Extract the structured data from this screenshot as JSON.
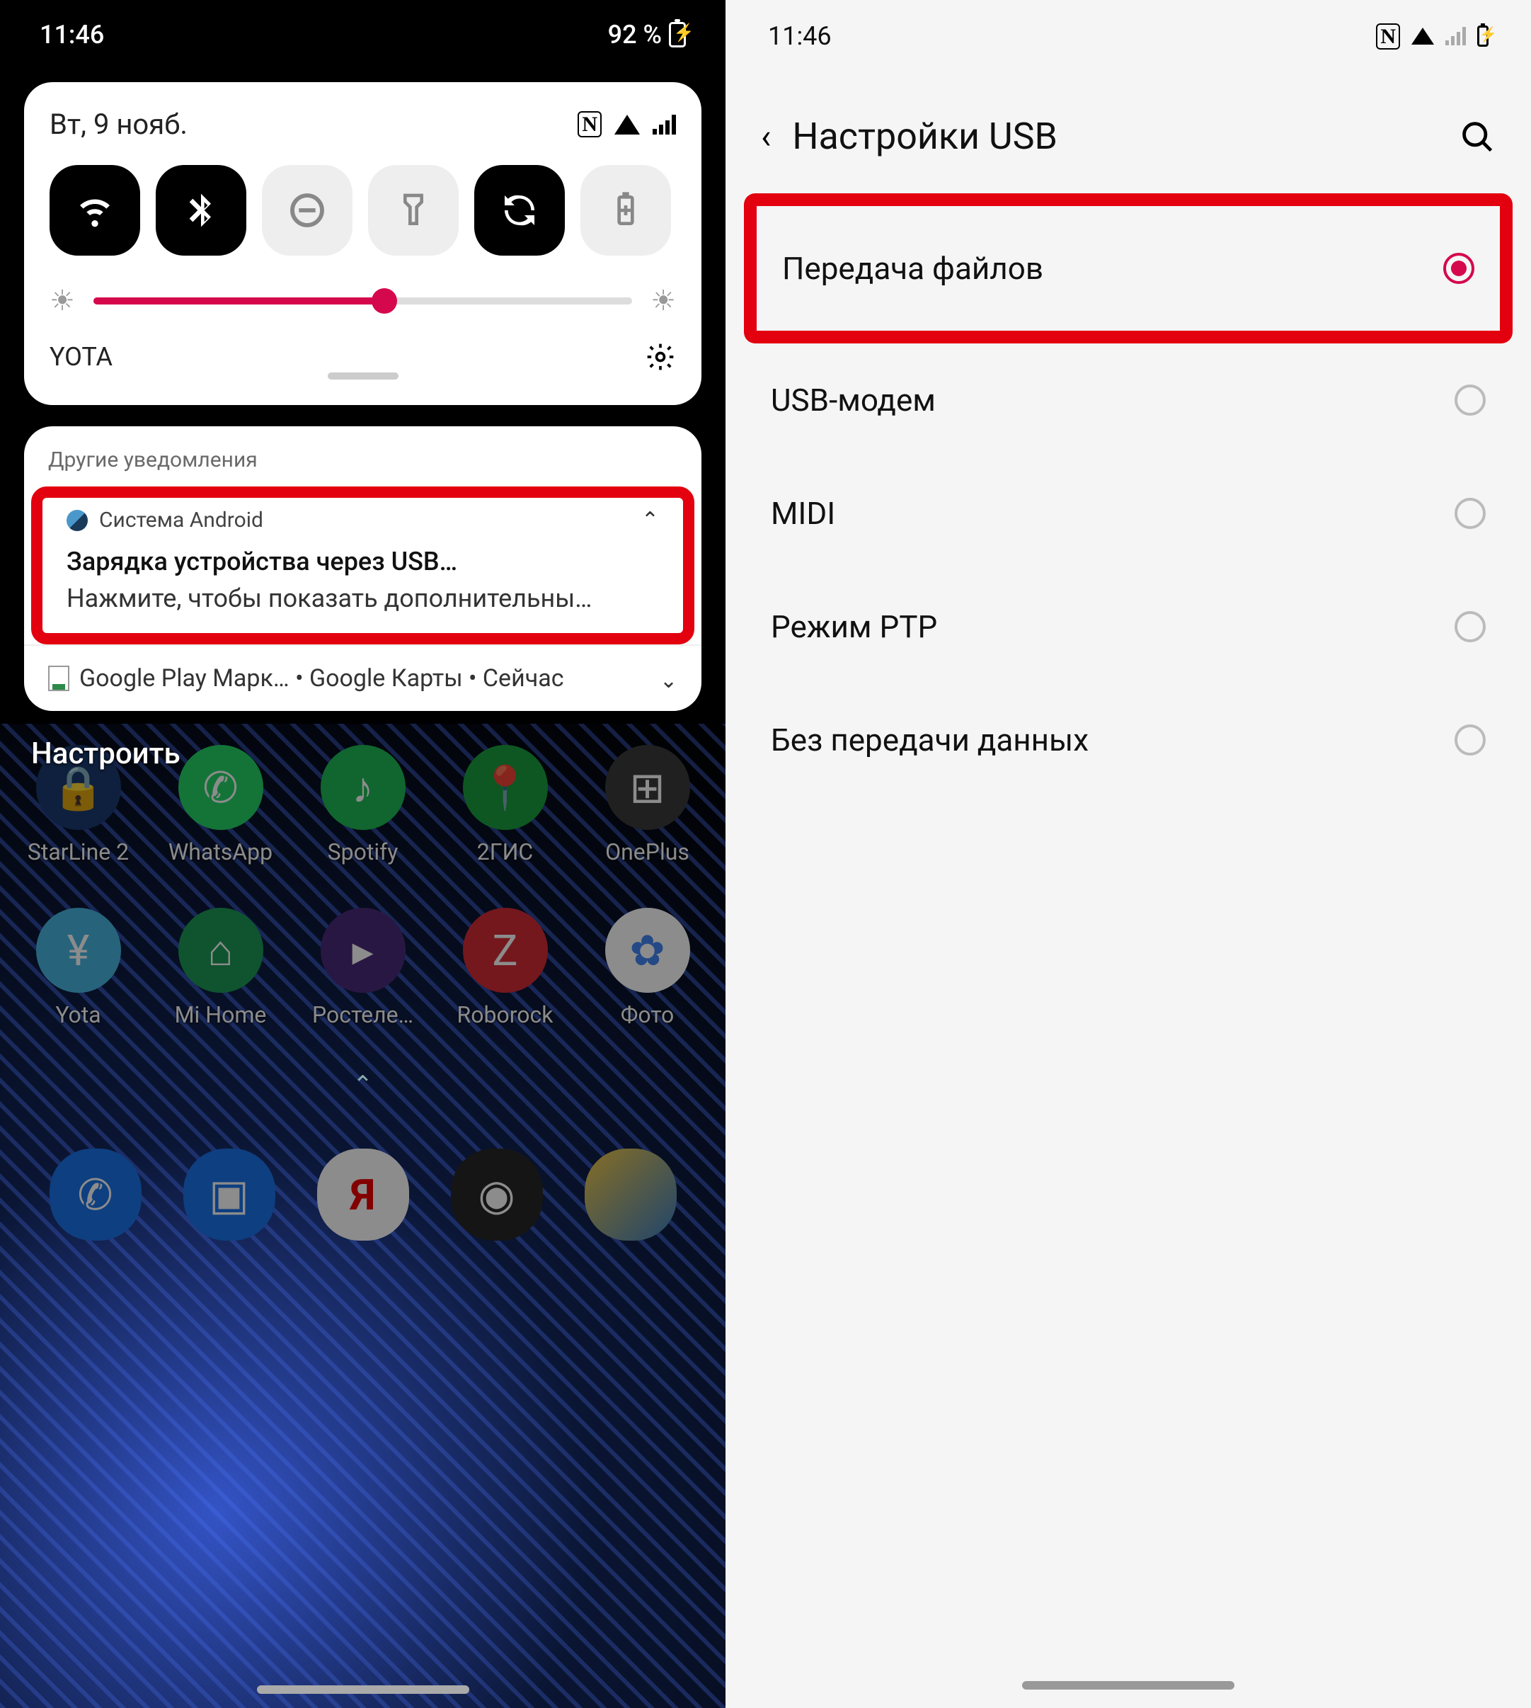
{
  "left": {
    "status": {
      "time": "11:46",
      "battery_pct": "92 %"
    },
    "qs": {
      "date": "Вт, 9 нояб.",
      "tiles": [
        "wifi",
        "bluetooth",
        "dnd",
        "flashlight",
        "rotate",
        "battery"
      ],
      "tile_states": {
        "wifi": true,
        "bluetooth": true,
        "dnd": false,
        "flashlight": false,
        "rotate": true,
        "battery": false
      },
      "carrier": "YOTA",
      "brightness_pct": 54
    },
    "notif": {
      "section_label": "Другие уведомления",
      "primary": {
        "app": "Система Android",
        "title": "Зарядка устройства через USB…",
        "body": "Нажмите, чтобы показать дополнительны…"
      },
      "collapsed": {
        "text": "Google Play Марк… • Google Карты • Сейчас"
      }
    },
    "customize_label": "Настроить",
    "apps_row1": [
      {
        "name": "StarLine 2",
        "color": "#1a3a6f"
      },
      {
        "name": "WhatsApp",
        "color": "#25d366"
      },
      {
        "name": "Spotify",
        "color": "#1db954"
      },
      {
        "name": "2ГИС",
        "color": "#1a9e3e"
      },
      {
        "name": "OnePlus",
        "color": "#3a3a3a"
      }
    ],
    "apps_row2": [
      {
        "name": "Yota",
        "color": "#47b5e2"
      },
      {
        "name": "Mi Home",
        "color": "#1b9955"
      },
      {
        "name": "Ростеле…",
        "color": "#4a2a7a"
      },
      {
        "name": "Roborock",
        "color": "#d22c36"
      },
      {
        "name": "Фото",
        "color": "#fff"
      }
    ],
    "dock": [
      {
        "name": "phone",
        "color": "#1a73e8",
        "glyph": "📞"
      },
      {
        "name": "messages",
        "color": "#1a73e8",
        "glyph": "💬"
      },
      {
        "name": "yandex",
        "color": "#fff",
        "glyph": "Я"
      },
      {
        "name": "camera",
        "color": "#262626",
        "glyph": "·"
      },
      {
        "name": "gallery",
        "color": "#2a3f5f",
        "glyph": ""
      }
    ]
  },
  "right": {
    "status": {
      "time": "11:46"
    },
    "title": "Настройки USB",
    "options": [
      {
        "label": "Передача файлов",
        "selected": true,
        "highlighted": true
      },
      {
        "label": "USB-модем",
        "selected": false
      },
      {
        "label": "MIDI",
        "selected": false
      },
      {
        "label": "Режим PTP",
        "selected": false
      },
      {
        "label": "Без передачи данных",
        "selected": false
      }
    ]
  }
}
